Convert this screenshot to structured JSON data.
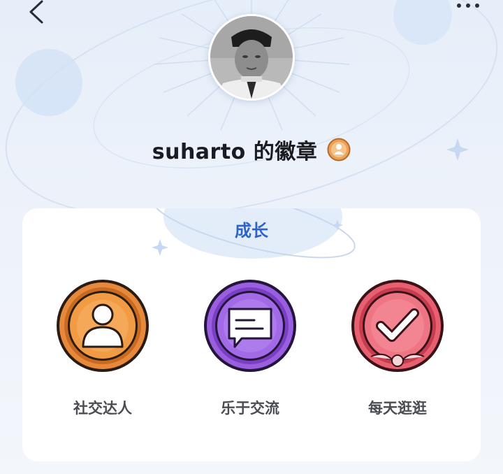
{
  "header": {
    "back_icon": "chevron-left-icon",
    "more_icon": "more-dots-icon",
    "avatar_icon": "user-avatar-photo",
    "title": "suharto 的徽章",
    "lock_icon": "lock-badge-icon"
  },
  "section": {
    "title": "成长",
    "badges": [
      {
        "label": "社交达人",
        "icon": "person-badge-icon",
        "color": "#d9792a"
      },
      {
        "label": "乐于交流",
        "icon": "chat-badge-icon",
        "color": "#8b4fd0"
      },
      {
        "label": "每天逛逛",
        "icon": "check-badge-icon",
        "color": "#d94b5e"
      }
    ]
  },
  "colors": {
    "accent": "#2b63c9",
    "background": "#edf2fa",
    "card": "#ffffff"
  }
}
